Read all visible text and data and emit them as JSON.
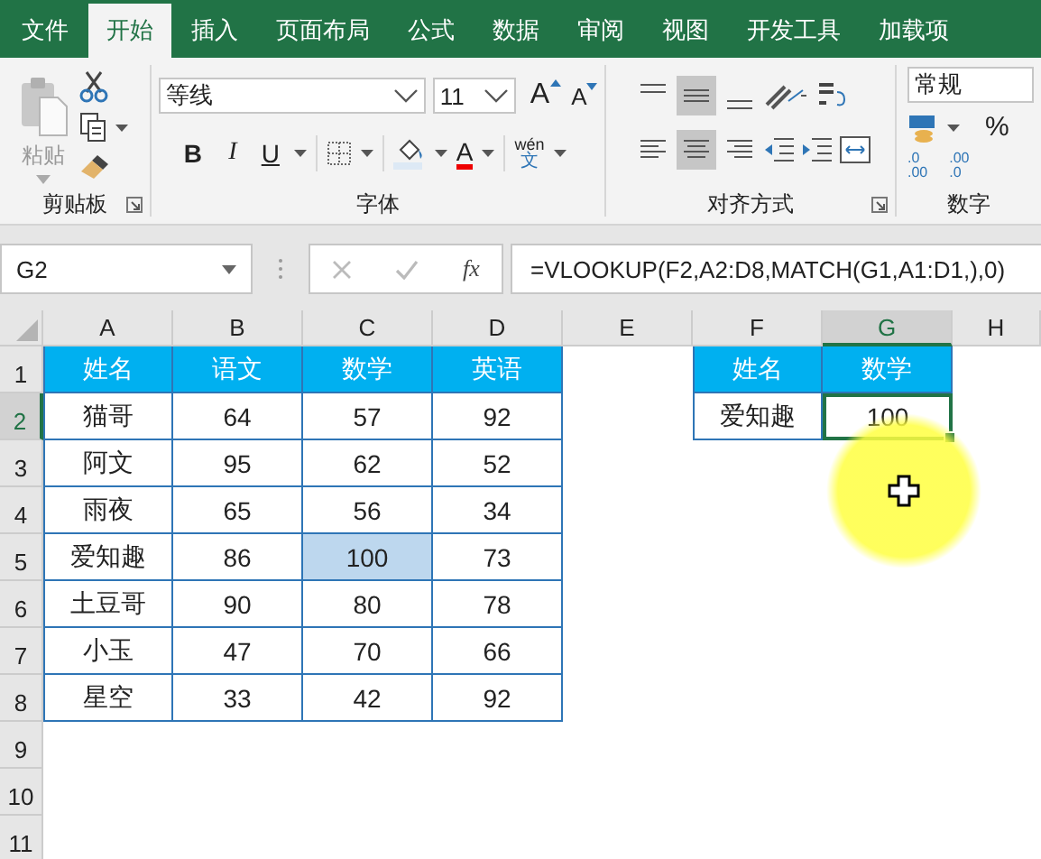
{
  "tabs": [
    {
      "label": "文件",
      "selected": false
    },
    {
      "label": "开始",
      "selected": true
    },
    {
      "label": "插入",
      "selected": false
    },
    {
      "label": "页面布局",
      "selected": false
    },
    {
      "label": "公式",
      "selected": false
    },
    {
      "label": "数据",
      "selected": false
    },
    {
      "label": "审阅",
      "selected": false
    },
    {
      "label": "视图",
      "selected": false
    },
    {
      "label": "开发工具",
      "selected": false
    },
    {
      "label": "加载项",
      "selected": false
    }
  ],
  "ribbon": {
    "clipboard": {
      "paste_label": "粘贴",
      "title": "剪贴板"
    },
    "font": {
      "font_name": "等线",
      "font_size": "11",
      "grow_letter": "A",
      "shrink_letter": "A",
      "bold": "B",
      "italic": "I",
      "underline": "U",
      "color_letter": "A",
      "phonetic_top": "wén",
      "phonetic_bottom": "文",
      "title": "字体"
    },
    "alignment": {
      "title": "对齐方式"
    },
    "number": {
      "format": "常规",
      "percent": "%",
      "increase_decimal": [
        ".0",
        ".00"
      ],
      "decrease_decimal": [
        ".00",
        ".0"
      ],
      "title": "数字"
    }
  },
  "formula_bar": {
    "name_box": "G2",
    "fx": "fx",
    "formula": "=VLOOKUP(F2,A2:D8,MATCH(G1,A1:D1,),0)"
  },
  "sheet": {
    "columns": [
      {
        "label": "A",
        "selected": false
      },
      {
        "label": "B",
        "selected": false
      },
      {
        "label": "C",
        "selected": false
      },
      {
        "label": "D",
        "selected": false
      },
      {
        "label": "E",
        "selected": false
      },
      {
        "label": "F",
        "selected": false
      },
      {
        "label": "G",
        "selected": true
      },
      {
        "label": "H",
        "selected": false
      }
    ],
    "rows": [
      {
        "label": "1",
        "selected": false
      },
      {
        "label": "2",
        "selected": true
      },
      {
        "label": "3",
        "selected": false
      },
      {
        "label": "4",
        "selected": false
      },
      {
        "label": "5",
        "selected": false
      },
      {
        "label": "6",
        "selected": false
      },
      {
        "label": "7",
        "selected": false
      },
      {
        "label": "8",
        "selected": false
      },
      {
        "label": "9",
        "selected": false
      },
      {
        "label": "10",
        "selected": false
      },
      {
        "label": "11",
        "selected": false
      }
    ]
  },
  "data_table": {
    "header": [
      "姓名",
      "语文",
      "数学",
      "英语"
    ],
    "rows": [
      {
        "cells": [
          {
            "text": "猫哥",
            "highlighted": false
          },
          {
            "text": "64",
            "highlighted": false
          },
          {
            "text": "57",
            "highlighted": false
          },
          {
            "text": "92",
            "highlighted": false
          }
        ]
      },
      {
        "cells": [
          {
            "text": "阿文",
            "highlighted": false
          },
          {
            "text": "95",
            "highlighted": false
          },
          {
            "text": "62",
            "highlighted": false
          },
          {
            "text": "52",
            "highlighted": false
          }
        ]
      },
      {
        "cells": [
          {
            "text": "雨夜",
            "highlighted": false
          },
          {
            "text": "65",
            "highlighted": false
          },
          {
            "text": "56",
            "highlighted": false
          },
          {
            "text": "34",
            "highlighted": false
          }
        ]
      },
      {
        "cells": [
          {
            "text": "爱知趣",
            "highlighted": false
          },
          {
            "text": "86",
            "highlighted": false
          },
          {
            "text": "100",
            "highlighted": true
          },
          {
            "text": "73",
            "highlighted": false
          }
        ]
      },
      {
        "cells": [
          {
            "text": "土豆哥",
            "highlighted": false
          },
          {
            "text": "90",
            "highlighted": false
          },
          {
            "text": "80",
            "highlighted": false
          },
          {
            "text": "78",
            "highlighted": false
          }
        ]
      },
      {
        "cells": [
          {
            "text": "小玉",
            "highlighted": false
          },
          {
            "text": "47",
            "highlighted": false
          },
          {
            "text": "70",
            "highlighted": false
          },
          {
            "text": "66",
            "highlighted": false
          }
        ]
      },
      {
        "cells": [
          {
            "text": "星空",
            "highlighted": false
          },
          {
            "text": "33",
            "highlighted": false
          },
          {
            "text": "42",
            "highlighted": false
          },
          {
            "text": "92",
            "highlighted": false
          }
        ]
      }
    ]
  },
  "lookup_table": {
    "header": [
      "姓名",
      "数学"
    ],
    "rows": [
      {
        "cells": [
          {
            "text": "爱知趣",
            "active": false
          },
          {
            "text": "100",
            "active": true
          }
        ]
      }
    ]
  }
}
